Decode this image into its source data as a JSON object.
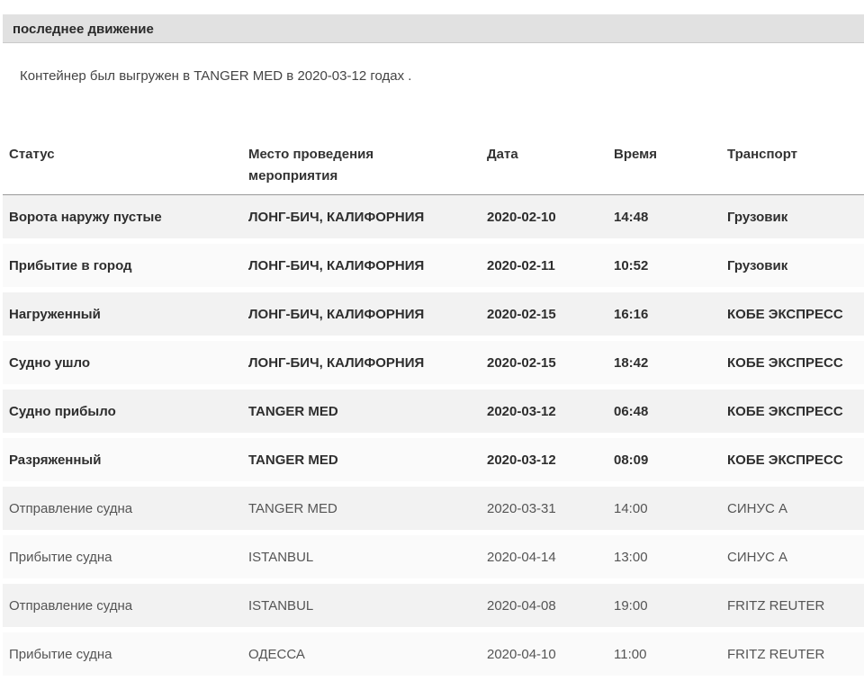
{
  "section": {
    "title": "последнее движение",
    "summary": "Контейнер был выгружен в TANGER MED в 2020-03-12 годах ."
  },
  "table": {
    "headers": {
      "status": "Статус",
      "place_line1": "Место проведения",
      "place_line2": "мероприятия",
      "date": "Дата",
      "time": "Время",
      "transport": "Транспорт"
    },
    "rows": [
      {
        "status": "Ворота наружу пустые",
        "place": "ЛОНГ-БИЧ, КАЛИФОРНИЯ",
        "date": "2020-02-10",
        "time": "14:48",
        "transport": "Грузовик",
        "emphasis": "bold"
      },
      {
        "status": "Прибытие в город",
        "place": "ЛОНГ-БИЧ, КАЛИФОРНИЯ",
        "date": "2020-02-11",
        "time": "10:52",
        "transport": "Грузовик",
        "emphasis": "bold"
      },
      {
        "status": "Нагруженный",
        "place": "ЛОНГ-БИЧ, КАЛИФОРНИЯ",
        "date": "2020-02-15",
        "time": "16:16",
        "transport": "КОБЕ ЭКСПРЕСС",
        "emphasis": "bold"
      },
      {
        "status": "Судно ушло",
        "place": "ЛОНГ-БИЧ, КАЛИФОРНИЯ",
        "date": "2020-02-15",
        "time": "18:42",
        "transport": "КОБЕ ЭКСПРЕСС",
        "emphasis": "bold"
      },
      {
        "status": "Судно прибыло",
        "place": "TANGER MED",
        "date": "2020-03-12",
        "time": "06:48",
        "transport": "КОБЕ ЭКСПРЕСС",
        "emphasis": "bold"
      },
      {
        "status": "Разряженный",
        "place": "TANGER MED",
        "date": "2020-03-12",
        "time": "08:09",
        "transport": "КОБЕ ЭКСПРЕСС",
        "emphasis": "bold"
      },
      {
        "status": "Отправление судна",
        "place": "TANGER MED",
        "date": "2020-03-31",
        "time": "14:00",
        "transport": "СИНУС А",
        "emphasis": "normal"
      },
      {
        "status": "Прибытие судна",
        "place": "ISTANBUL",
        "date": "2020-04-14",
        "time": "13:00",
        "transport": "СИНУС А",
        "emphasis": "normal"
      },
      {
        "status": "Отправление судна",
        "place": "ISTANBUL",
        "date": "2020-04-08",
        "time": "19:00",
        "transport": "FRITZ REUTER",
        "emphasis": "normal"
      },
      {
        "status": "Прибытие судна",
        "place": "ОДЕССА",
        "date": "2020-04-10",
        "time": "11:00",
        "transport": "FRITZ REUTER",
        "emphasis": "normal"
      }
    ]
  },
  "colors": {
    "header_band": "#e1e1e1",
    "row_shade": "#f2f2f2",
    "row_light": "#fafafa",
    "text": "#333333"
  }
}
